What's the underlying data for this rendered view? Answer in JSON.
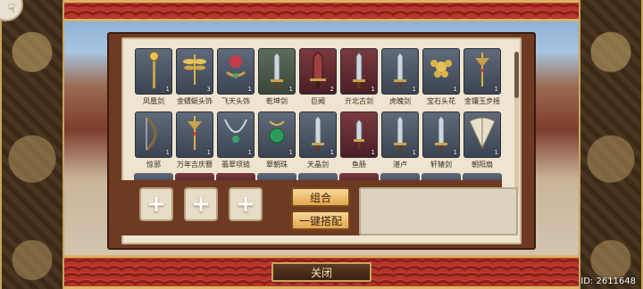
{
  "items_row1": [
    {
      "label": "凤凰剑",
      "count": "1",
      "tone": "blue",
      "icon": "staff-icon"
    },
    {
      "label": "金蜻蜓头饰",
      "count": "3",
      "tone": "blue",
      "icon": "dragonfly-hairpin-icon"
    },
    {
      "label": "飞天头饰",
      "count": "1",
      "tone": "blue",
      "icon": "headdress-icon"
    },
    {
      "label": "乾坤剑",
      "count": "1",
      "tone": "green",
      "icon": "sword-icon"
    },
    {
      "label": "巨阙",
      "count": "2",
      "tone": "red",
      "icon": "greatsword-icon"
    },
    {
      "label": "亓北古剑",
      "count": "1",
      "tone": "red",
      "icon": "sword-icon"
    },
    {
      "label": "虎魄剑",
      "count": "1",
      "tone": "blue",
      "icon": "sword-icon"
    },
    {
      "label": "宝石头花",
      "count": "1",
      "tone": "blue",
      "icon": "jewel-flower-icon"
    },
    {
      "label": "金镶玉步摇",
      "count": "1",
      "tone": "blue",
      "icon": "hairpin-icon"
    }
  ],
  "items_row2": [
    {
      "label": "惊邪",
      "count": "1",
      "tone": "blue",
      "icon": "bow-icon"
    },
    {
      "label": "万年吉庆簪",
      "count": "1",
      "tone": "blue",
      "icon": "hairpin-icon"
    },
    {
      "label": "翡翠项链",
      "count": "1",
      "tone": "blue",
      "icon": "necklace-icon"
    },
    {
      "label": "翠朝珠",
      "count": "1",
      "tone": "blue",
      "icon": "jade-bead-icon"
    },
    {
      "label": "天晶剑",
      "count": "1",
      "tone": "blue",
      "icon": "sword-icon"
    },
    {
      "label": "鱼肠",
      "count": "1",
      "tone": "red",
      "icon": "dagger-icon"
    },
    {
      "label": "湛卢",
      "count": "1",
      "tone": "blue",
      "icon": "sword-icon"
    },
    {
      "label": "轩辕剑",
      "count": "1",
      "tone": "blue",
      "icon": "sword-icon"
    },
    {
      "label": "朝阳扇",
      "count": "1",
      "tone": "blue",
      "icon": "fan-icon"
    }
  ],
  "buttons": {
    "combine": "组合",
    "auto_match": "一键搭配",
    "close": "关闭",
    "plus": "+"
  },
  "corner_glyph": "☟",
  "footer": {
    "id": "ID: 2611648"
  },
  "colors": {
    "frame": "#6e3b22",
    "panel": "#efe4cf",
    "button_gold": "#e3a64d",
    "banner_red": "#b5352c"
  }
}
